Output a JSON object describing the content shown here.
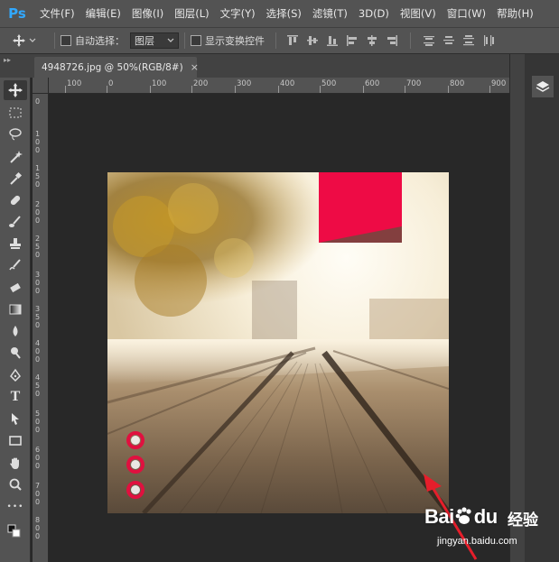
{
  "app": {
    "logo": "Ps",
    "brand_color": "#31a8ff"
  },
  "menu": [
    "文件(F)",
    "编辑(E)",
    "图像(I)",
    "图层(L)",
    "文字(Y)",
    "选择(S)",
    "滤镜(T)",
    "3D(D)",
    "视图(V)",
    "窗口(W)",
    "帮助(H)"
  ],
  "options": {
    "auto_select_label": "自动选择：",
    "auto_select_value": "图层",
    "transform_controls_label": "显示变换控件"
  },
  "document": {
    "tab_title": "4948726.jpg @ 50%(RGB/8#)",
    "close_glyph": "×"
  },
  "ruler": {
    "top": [
      "100",
      "0",
      "100",
      "200",
      "300",
      "400",
      "500",
      "600",
      "700",
      "800",
      "900"
    ],
    "left": [
      "0",
      "1\n0\n0",
      "1\n5\n0",
      "2\n0\n0",
      "2\n5\n0",
      "3\n0\n0",
      "3\n5\n0",
      "4\n0\n0",
      "4\n5\n0",
      "5\n0\n0",
      "6\n0\n0",
      "7\n0\n0",
      "8\n0\n0"
    ]
  },
  "tools": [
    "move-tool",
    "marquee-tool",
    "lasso-tool",
    "magic-wand-tool",
    "eyedropper-tool",
    "healing-brush-tool",
    "brush-tool",
    "clone-stamp-tool",
    "history-brush-tool",
    "eraser-tool",
    "gradient-tool",
    "blur-tool",
    "dodge-tool",
    "pen-tool",
    "type-tool",
    "path-selection-tool",
    "rectangle-tool",
    "hand-tool",
    "zoom-tool",
    "more-tools",
    "color-swatches"
  ],
  "type_tool_glyph": "T",
  "more_tools_glyph": "•••",
  "canvas": {
    "banner_color": "#ee0b45",
    "circle_color": "#e0103f",
    "circles": 3
  },
  "watermark": {
    "brand": "Bai",
    "brand_du": "du",
    "title": "经验",
    "url": "jingyan.baidu.com"
  }
}
